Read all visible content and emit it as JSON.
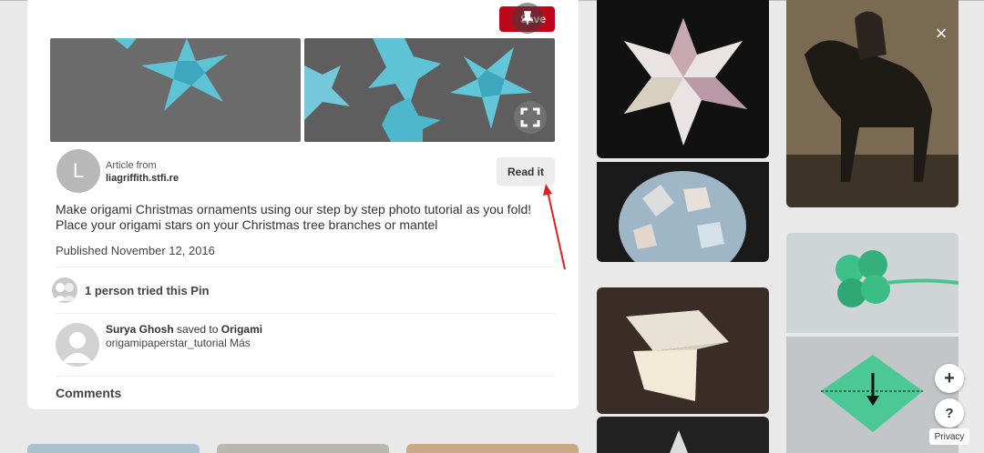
{
  "pin": {
    "save_label": "Save",
    "article_label": "Article from",
    "source": "liagriffith.stfi.re",
    "avatar_letter": "L",
    "read_label": "Read it",
    "description": "Make origami Christmas ornaments using our step by step photo tutorial as you fold! Place your origami stars on your Christmas tree branches or mantel",
    "published": "Published November 12, 2016",
    "tried": "1 person tried this Pin",
    "saver_name": "Surya Ghosh",
    "saved_to": "saved to",
    "board": "Origami",
    "saved_sub": "origamipaperstar_tutorial Más",
    "comments_label": "Comments"
  },
  "floating": {
    "add_label": "+",
    "help_label": "?",
    "privacy_label": "Privacy",
    "close_label": "×"
  },
  "colors": {
    "save_red": "#bd081c",
    "annotation_arrow": "#e02020"
  },
  "icons": [
    "pin-icon",
    "expand-icon",
    "close-icon",
    "plus-icon",
    "help-icon"
  ]
}
